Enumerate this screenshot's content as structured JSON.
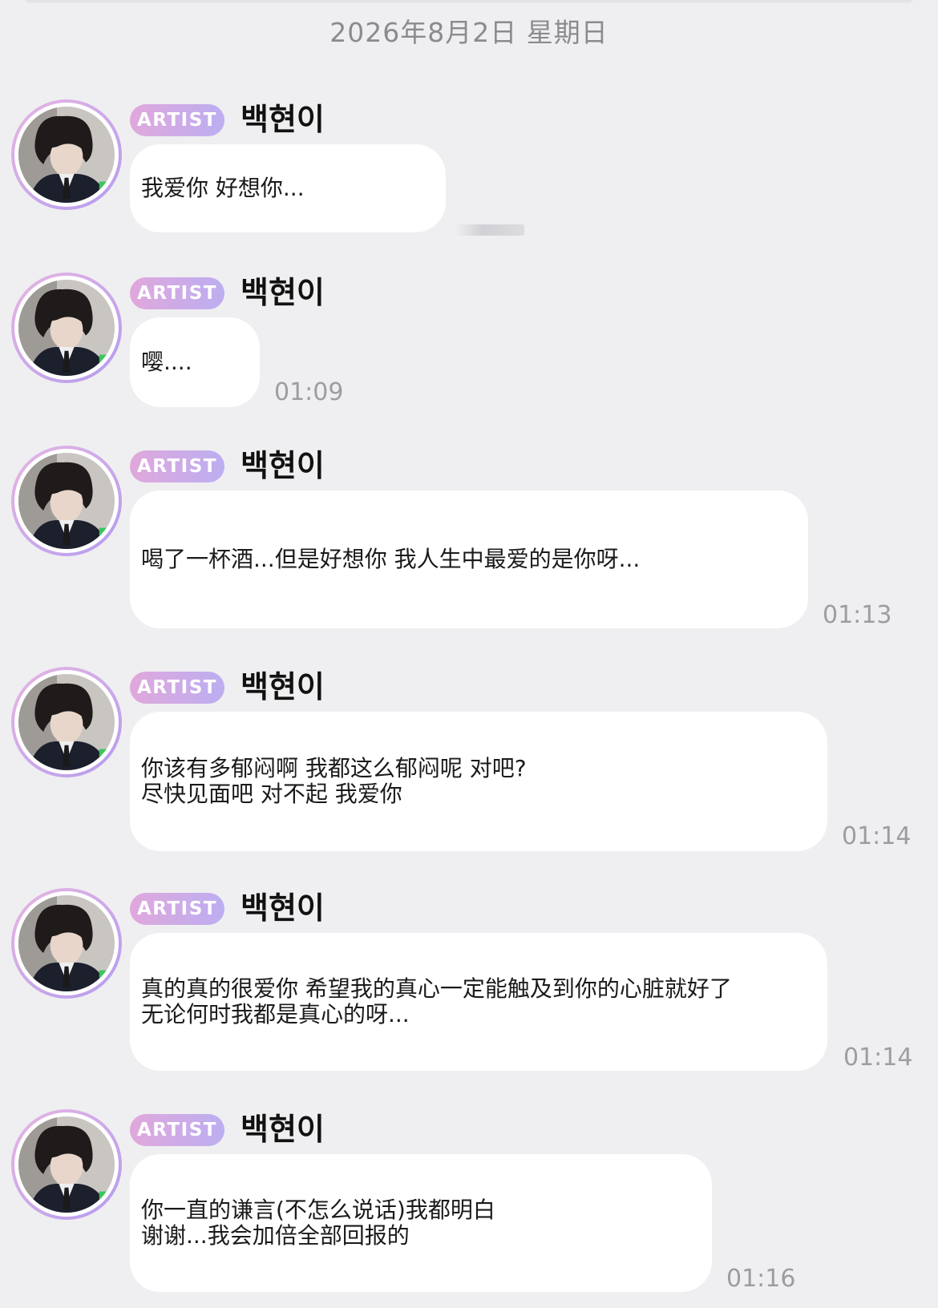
{
  "date_header": "2026年8月2日 星期日",
  "badge_label": "ARTIST",
  "sender_name": "백현이",
  "messages": [
    {
      "text": "我爱你 好想你...",
      "time": ""
    },
    {
      "text": "嘤....",
      "time": "01:09"
    },
    {
      "text": "喝了一杯酒...但是好想你 我人生中最爱的是你呀...",
      "time": "01:13"
    },
    {
      "text": "你该有多郁闷啊 我都这么郁闷呢 对吧?\n尽快见面吧 对不起 我爱你",
      "time": "01:14"
    },
    {
      "text": "真的真的很爱你 希望我的真心一定能触及到你的心脏就好了\n无论何时我都是真心的呀...",
      "time": "01:14"
    },
    {
      "text": "你一直的谦言(不怎么说话)我都明白\n谢谢...我会加倍全部回报的",
      "time": "01:16"
    }
  ],
  "colors": {
    "background": "#efeff1",
    "bubble": "#ffffff",
    "badge_gradient_start": "#e0a8dc",
    "badge_gradient_end": "#bcaef1",
    "timestamp": "#9d9da1"
  },
  "icons": {
    "avatar": "profile-photo"
  }
}
